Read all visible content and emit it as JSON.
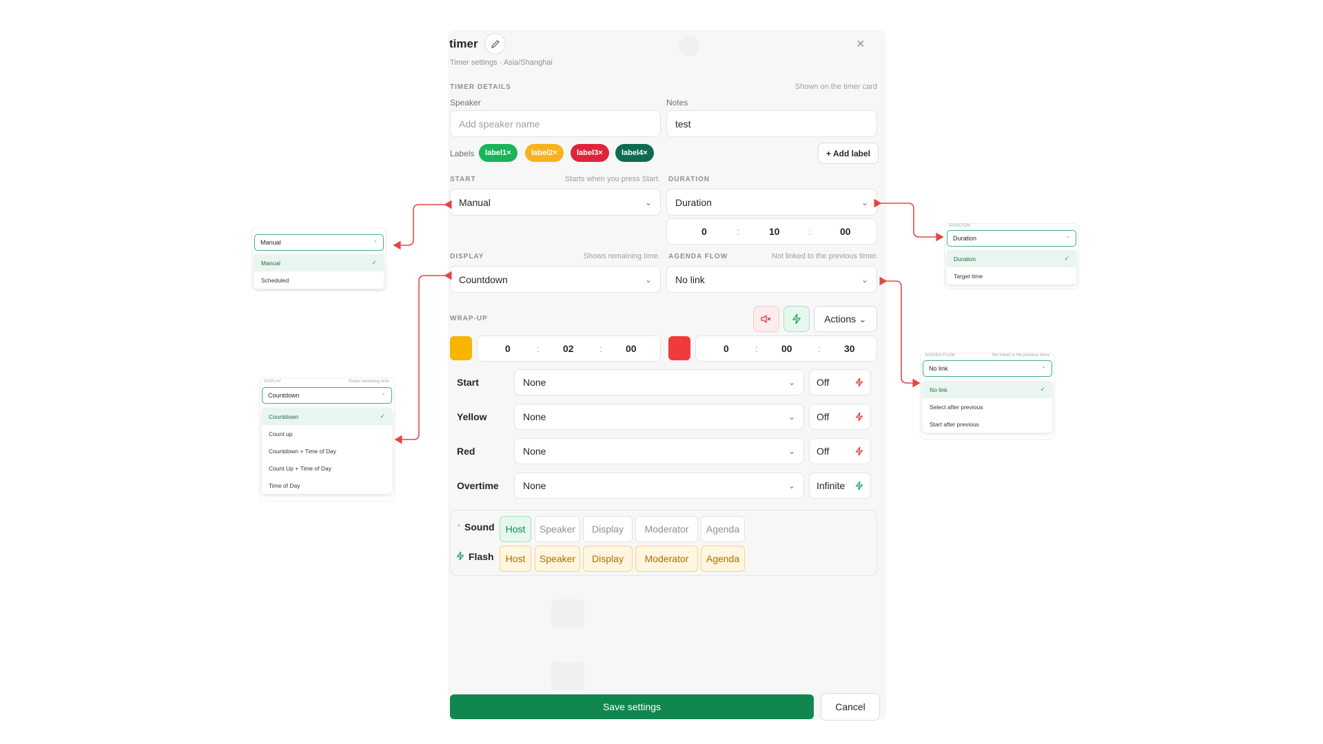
{
  "header": {
    "title": "timer",
    "subtitle": "Timer settings · Asia/Shanghai"
  },
  "details": {
    "section": "TIMER DETAILS",
    "hint": "Shown on the timer card",
    "speaker_label": "Speaker",
    "speaker_placeholder": "Add speaker name",
    "notes_label": "Notes",
    "notes_value": "test",
    "labels_label": "Labels",
    "labels": [
      {
        "text": "label1",
        "color": "#19b35a"
      },
      {
        "text": "label2",
        "color": "#f6b31c"
      },
      {
        "text": "label3",
        "color": "#e0233c"
      },
      {
        "text": "label4",
        "color": "#0f6b4f"
      }
    ],
    "add_label": "+ Add label"
  },
  "start": {
    "section": "START",
    "hint": "Starts when you press Start.",
    "value": "Manual",
    "options": [
      "Manual",
      "Scheduled"
    ]
  },
  "duration": {
    "section": "DURATION",
    "value": "Duration",
    "h": "0",
    "m": "10",
    "s": "00",
    "options": [
      "Duration",
      "Target time"
    ]
  },
  "display": {
    "section": "DISPLAY",
    "hint": "Shows remaining time.",
    "value": "Countdown",
    "options": [
      "Countdown",
      "Count up",
      "Countdown + Time of Day",
      "Count Up + Time of Day",
      "Time of Day"
    ]
  },
  "agenda": {
    "section": "AGENDA FLOW",
    "hint": "Not linked to the previous timer.",
    "value": "No link",
    "options": [
      "No link",
      "Select after previous",
      "Start after previous"
    ]
  },
  "wrapup": {
    "section": "WRAP-UP",
    "actions": "Actions",
    "yellow": {
      "color": "#f7b500",
      "h": "0",
      "m": "02",
      "s": "00"
    },
    "red": {
      "color": "#ef3b3b",
      "h": "0",
      "m": "00",
      "s": "30"
    },
    "rows": [
      {
        "label": "Start",
        "select": "None",
        "toggle": "Off"
      },
      {
        "label": "Yellow",
        "select": "None",
        "toggle": "Off"
      },
      {
        "label": "Red",
        "select": "None",
        "toggle": "Off"
      },
      {
        "label": "Overtime",
        "select": "None",
        "toggle": "Infinite"
      }
    ]
  },
  "notify": {
    "sound_label": "Sound",
    "flash_label": "Flash",
    "targets": [
      "Host",
      "Speaker",
      "Display",
      "Moderator",
      "Agenda"
    ]
  },
  "footer": {
    "save": "Save settings",
    "cancel": "Cancel"
  },
  "colors": {
    "accent": "#10874f",
    "arrow": "#e64545"
  }
}
